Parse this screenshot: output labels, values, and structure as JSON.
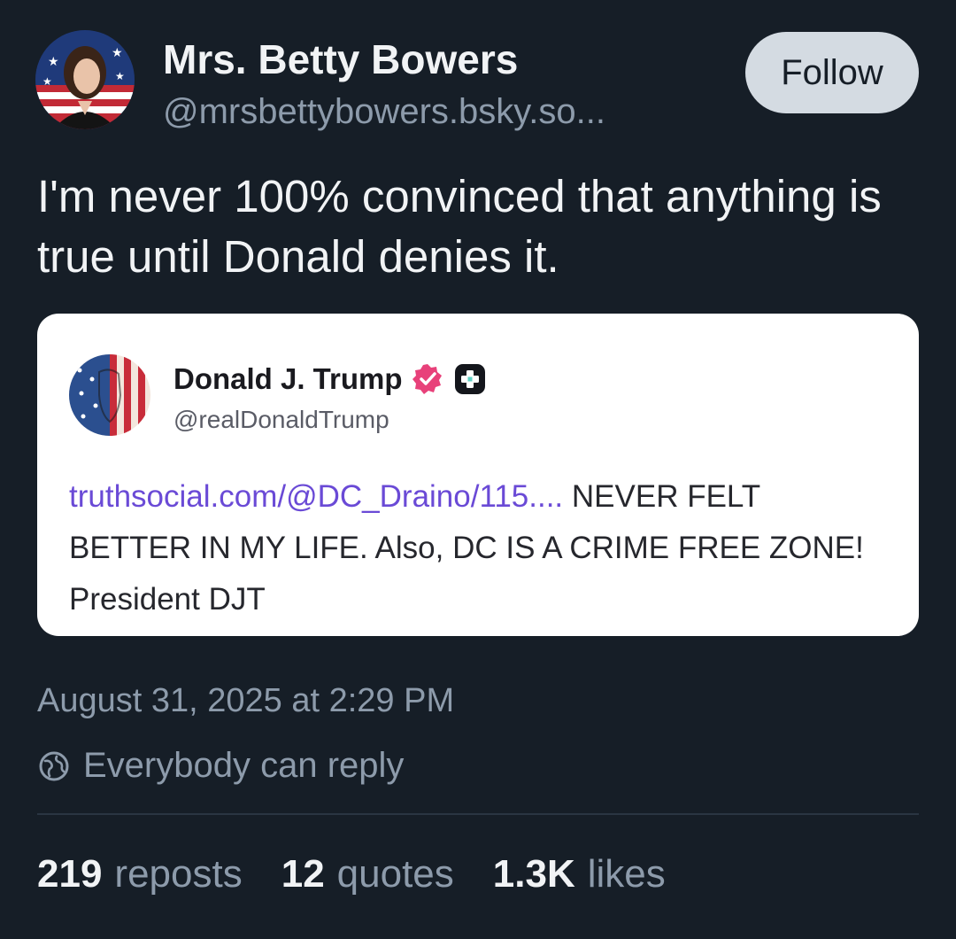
{
  "author": {
    "name": "Mrs. Betty Bowers",
    "handle": "@mrsbettybowers.bsky.so..."
  },
  "follow_label": "Follow",
  "post_text": "I'm never 100% convinced that anything is true until Donald denies it.",
  "embed": {
    "name": "Donald J. Trump",
    "handle": "@realDonaldTrump",
    "link": "truthsocial.com/@DC_Draino/115....",
    "text": " NEVER FELT BETTER IN MY LIFE. Also, DC IS A CRIME FREE ZONE! President DJT"
  },
  "timestamp": "August 31, 2025 at 2:29 PM",
  "reply_setting": "Everybody can reply",
  "stats": {
    "reposts_count": "219",
    "reposts_label": "reposts",
    "quotes_count": "12",
    "quotes_label": "quotes",
    "likes_count": "1.3K",
    "likes_label": "likes"
  },
  "colors": {
    "background": "#161e27",
    "muted_text": "#8d9bab",
    "follow_button_bg": "#d4dbe2",
    "link": "#6a4ad6",
    "verified_badge": "#e8417a"
  },
  "icons": [
    "globe-icon",
    "verified-icon",
    "plus-badge-icon"
  ]
}
